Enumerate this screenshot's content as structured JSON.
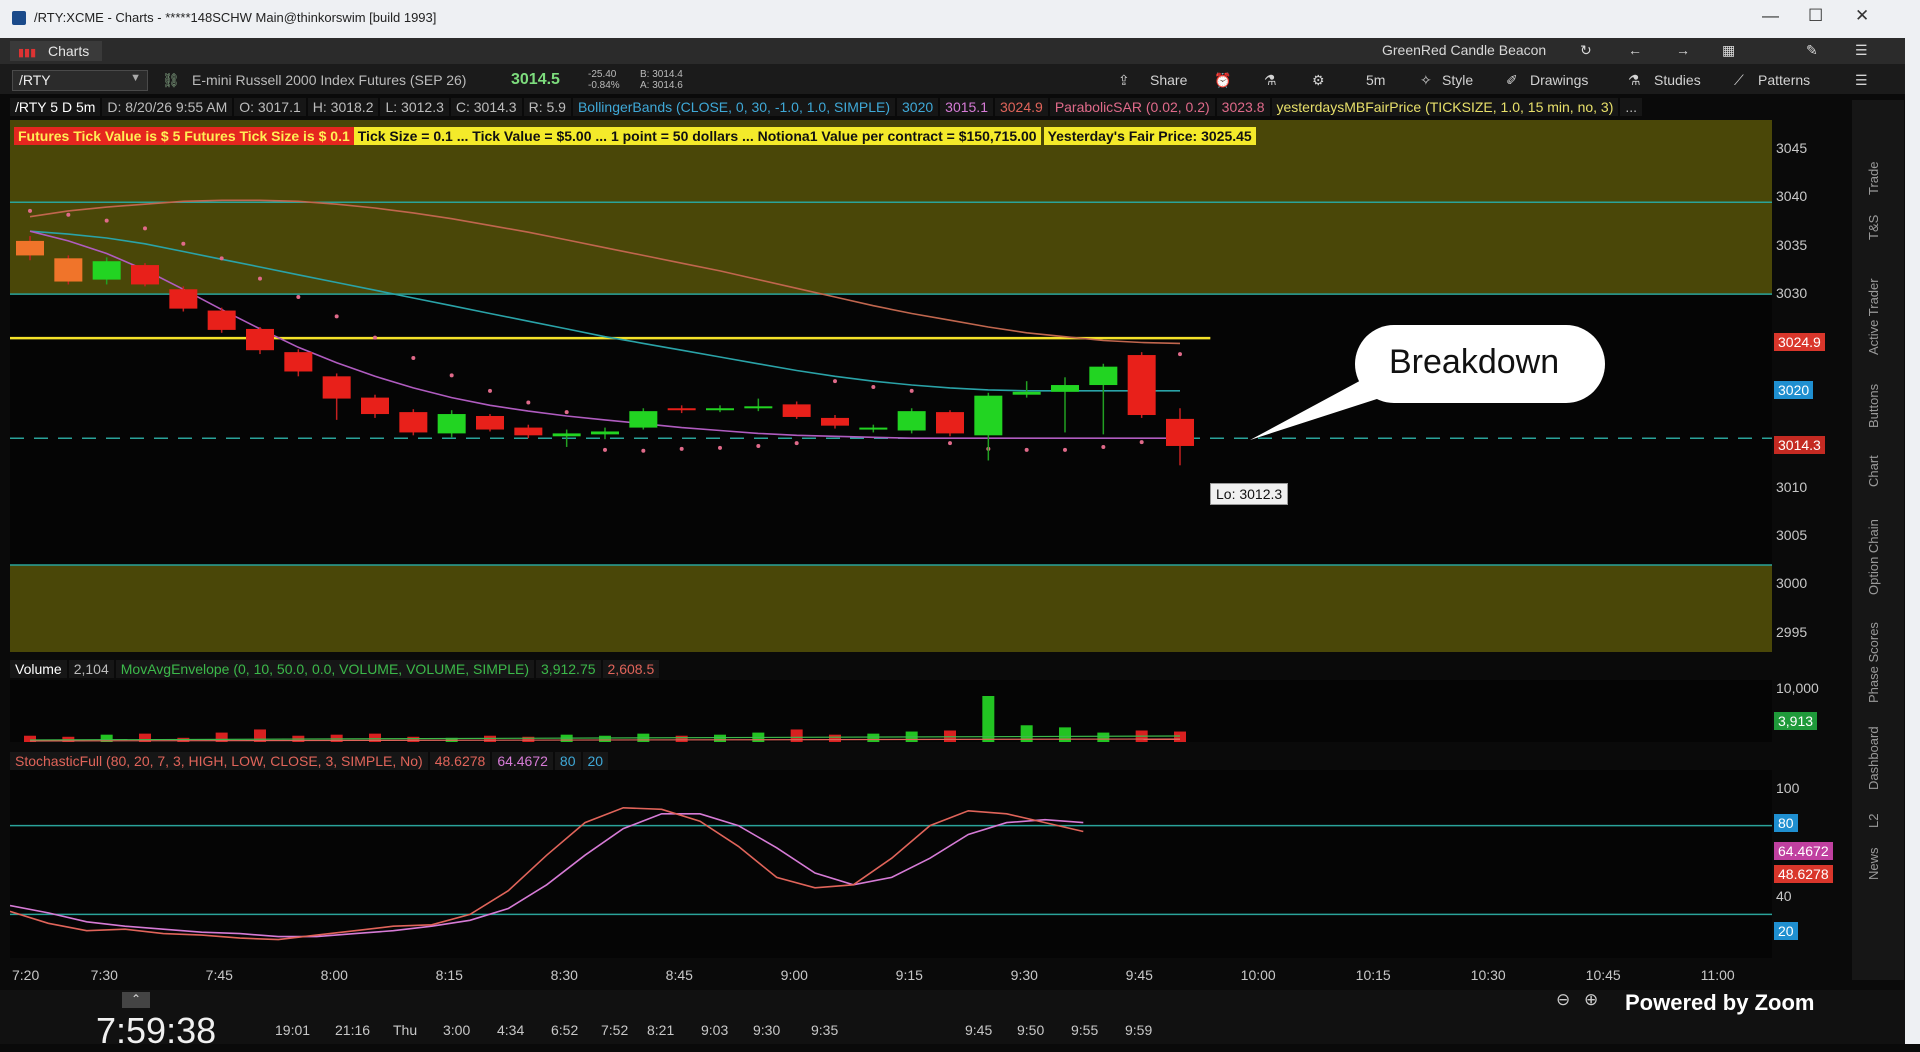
{
  "window": {
    "title": "/RTY:XCME - Charts - *****148SCHW Main@thinkorswim [build 1993]",
    "controls": [
      "—",
      "☐",
      "✕"
    ]
  },
  "topbar": {
    "tab_label": "Charts",
    "beacon_label": "GreenRed Candle Beacon"
  },
  "toolbar": {
    "symbol": "/RTY",
    "description": "E-mini Russell 2000 Index Futures (SEP 26)",
    "last": "3014.5",
    "change": "-25.40",
    "change_pct": "-0.84%",
    "bid": "B: 3014.4",
    "ask": "A: 3014.6",
    "share": "Share",
    "timeframe": "5m",
    "style": "Style",
    "drawings": "Drawings",
    "studies": "Studies",
    "patterns": "Patterns"
  },
  "header": {
    "cells": [
      {
        "text": "/RTY 5 D 5m",
        "color": "#ffffff"
      },
      {
        "text": "D: 8/20/26 9:55 AM",
        "color": "#bdbdbd"
      },
      {
        "text": "O: 3017.1",
        "color": "#bdbdbd"
      },
      {
        "text": "H: 3018.2",
        "color": "#bdbdbd"
      },
      {
        "text": "L: 3012.3",
        "color": "#bdbdbd"
      },
      {
        "text": "C: 3014.3",
        "color": "#bdbdbd"
      },
      {
        "text": "R: 5.9",
        "color": "#bdbdbd"
      },
      {
        "text": "BollingerBands (CLOSE, 0, 30, -1.0, 1.0, SIMPLE)",
        "color": "#3fa9d8"
      },
      {
        "text": "3020",
        "color": "#3fa9d8"
      },
      {
        "text": "3015.1",
        "color": "#d67bd6"
      },
      {
        "text": "3024.9",
        "color": "#e0645a"
      },
      {
        "text": "ParabolicSAR (0.02, 0.2)",
        "color": "#e06a8a"
      },
      {
        "text": "3023.8",
        "color": "#e06a8a"
      },
      {
        "text": "yesterdaysMBFairPrice (TICKSIZE, 1.0, 15 min, no, 3)",
        "color": "#e8e06a"
      },
      {
        "text": "...",
        "color": "#bdbdbd"
      }
    ]
  },
  "info": {
    "red_text": "Futures Tick Value is $ 5  Futures Tick Size is $ 0.1",
    "yellow_text": "Tick Size =  0.1 ... Tick Value =  $5.00 ... 1 point = 50 dollars ... Notiona1 Value per contract =  $150,715.00",
    "fair_text": "Yesterday's Fair Price: 3025.45"
  },
  "price_axis": {
    "labels": [
      "3045",
      "3040",
      "3035",
      "3030",
      "3010",
      "3005",
      "3000",
      "2995"
    ],
    "badges": [
      {
        "text": "3024.9",
        "color": "#d9362b"
      },
      {
        "text": "3020",
        "color": "#1f8fd0"
      },
      {
        "text": "3014.3",
        "color": "#c42a22"
      }
    ]
  },
  "chart_data": {
    "type": "candlestick",
    "y_range": [
      2993,
      3048
    ],
    "levels": {
      "yellow_line": 3025.45,
      "dashed_line": 3015.1,
      "zone_upper": [
        3030,
        3048
      ],
      "zone_lower": [
        2993,
        3002
      ],
      "cyan_lines": [
        3039.5,
        3030,
        3002
      ]
    },
    "candles": [
      {
        "o": 3035.5,
        "c": 3034.0,
        "h": 3036.0,
        "l": 3033.5
      },
      {
        "o": 3033.7,
        "c": 3031.3,
        "h": 3034.0,
        "l": 3031.0
      },
      {
        "o": 3031.5,
        "c": 3033.4,
        "h": 3033.8,
        "l": 3031.0
      },
      {
        "o": 3033.0,
        "c": 3031.0,
        "h": 3033.2,
        "l": 3030.8
      },
      {
        "o": 3030.5,
        "c": 3028.5,
        "h": 3030.8,
        "l": 3028.2
      },
      {
        "o": 3028.3,
        "c": 3026.3,
        "h": 3028.6,
        "l": 3026.0
      },
      {
        "o": 3026.4,
        "c": 3024.2,
        "h": 3026.6,
        "l": 3023.8
      },
      {
        "o": 3024.0,
        "c": 3022.0,
        "h": 3024.3,
        "l": 3021.5
      },
      {
        "o": 3021.5,
        "c": 3019.2,
        "h": 3021.8,
        "l": 3017.0
      },
      {
        "o": 3019.3,
        "c": 3017.6,
        "h": 3019.6,
        "l": 3017.2
      },
      {
        "o": 3017.8,
        "c": 3015.7,
        "h": 3018.1,
        "l": 3015.4
      },
      {
        "o": 3015.6,
        "c": 3017.6,
        "h": 3018.0,
        "l": 3015.2
      },
      {
        "o": 3017.4,
        "c": 3016.0,
        "h": 3017.6,
        "l": 3015.8
      },
      {
        "o": 3016.2,
        "c": 3015.4,
        "h": 3016.5,
        "l": 3015.1
      },
      {
        "o": 3015.3,
        "c": 3015.6,
        "h": 3016.0,
        "l": 3014.2
      },
      {
        "o": 3015.5,
        "c": 3015.8,
        "h": 3016.2,
        "l": 3015.0
      },
      {
        "o": 3016.2,
        "c": 3017.9,
        "h": 3018.2,
        "l": 3016.0
      },
      {
        "o": 3018.2,
        "c": 3018.0,
        "h": 3018.5,
        "l": 3017.7
      },
      {
        "o": 3018.0,
        "c": 3018.2,
        "h": 3018.5,
        "l": 3017.8
      },
      {
        "o": 3018.3,
        "c": 3018.4,
        "h": 3019.2,
        "l": 3017.9
      },
      {
        "o": 3018.6,
        "c": 3017.3,
        "h": 3018.9,
        "l": 3017.1
      },
      {
        "o": 3017.2,
        "c": 3016.4,
        "h": 3017.5,
        "l": 3016.1
      },
      {
        "o": 3016.0,
        "c": 3016.2,
        "h": 3016.5,
        "l": 3015.7
      },
      {
        "o": 3015.9,
        "c": 3017.9,
        "h": 3018.2,
        "l": 3015.6
      },
      {
        "o": 3017.8,
        "c": 3015.6,
        "h": 3018.0,
        "l": 3015.3
      },
      {
        "o": 3015.4,
        "c": 3019.5,
        "h": 3019.8,
        "l": 3012.8
      },
      {
        "o": 3019.6,
        "c": 3019.9,
        "h": 3021.0,
        "l": 3019.3
      },
      {
        "o": 3019.9,
        "c": 3020.6,
        "h": 3021.4,
        "l": 3015.7
      },
      {
        "o": 3020.6,
        "c": 3022.5,
        "h": 3022.8,
        "l": 3015.5
      },
      {
        "o": 3023.7,
        "c": 3017.5,
        "h": 3024.0,
        "l": 3017.2
      },
      {
        "o": 3017.1,
        "c": 3014.3,
        "h": 3018.2,
        "l": 3012.3
      }
    ],
    "bb_mid": [
      3036.5,
      3036.2,
      3035.8,
      3035.2,
      3034.4,
      3033.6,
      3032.8,
      3032.0,
      3031.2,
      3030.4,
      3029.6,
      3028.8,
      3028.0,
      3027.2,
      3026.4,
      3025.6,
      3024.9,
      3024.2,
      3023.5,
      3022.8,
      3022.1,
      3021.5,
      3021.0,
      3020.6,
      3020.3,
      3020.1,
      3020.0,
      3020.0,
      3020.0,
      3020.0,
      3020.0
    ],
    "bb_upper": [
      3038.0,
      3038.6,
      3039.0,
      3039.3,
      3039.6,
      3039.7,
      3039.7,
      3039.6,
      3039.3,
      3038.9,
      3038.4,
      3037.8,
      3037.1,
      3036.4,
      3035.6,
      3034.8,
      3034.0,
      3033.2,
      3032.4,
      3031.5,
      3030.6,
      3029.7,
      3028.8,
      3028.0,
      3027.3,
      3026.6,
      3026.0,
      3025.6,
      3025.2,
      3025.0,
      3024.9
    ],
    "bb_lower": [
      3036.5,
      3035.5,
      3034.2,
      3032.5,
      3030.5,
      3028.4,
      3026.4,
      3024.5,
      3022.9,
      3021.5,
      3020.3,
      3019.3,
      3018.5,
      3017.9,
      3017.4,
      3017.0,
      3016.6,
      3016.2,
      3015.9,
      3015.6,
      3015.4,
      3015.3,
      3015.2,
      3015.1,
      3015.1,
      3015.1,
      3015.1,
      3015.1,
      3015.1,
      3015.1,
      3015.1
    ],
    "sar": [
      3038.6,
      3038.2,
      3037.6,
      3036.8,
      3035.2,
      3033.7,
      3031.6,
      3029.7,
      3027.7,
      3025.5,
      3023.4,
      3021.6,
      3020.0,
      3018.8,
      3017.8,
      3013.9,
      3013.8,
      3014.0,
      3014.1,
      3014.3,
      3014.6,
      3021.0,
      3020.4,
      3020.0,
      3014.6,
      3014.0,
      3013.9,
      3013.9,
      3014.2,
      3014.7,
      3023.8
    ],
    "volume": [
      30,
      25,
      35,
      40,
      20,
      45,
      60,
      30,
      35,
      40,
      25,
      20,
      30,
      25,
      35,
      30,
      40,
      30,
      35,
      45,
      60,
      35,
      40,
      50,
      55,
      220,
      80,
      70,
      45,
      55,
      50
    ],
    "volume_range": [
      0,
      12000
    ],
    "stoch_k": [
      22,
      14,
      9,
      10,
      7,
      6,
      4,
      3,
      6,
      9,
      12,
      13,
      20,
      36,
      60,
      82,
      92,
      91,
      83,
      66,
      45,
      38,
      40,
      58,
      80,
      90,
      88,
      82,
      76
    ],
    "stoch_d": [
      26,
      21,
      15,
      12,
      10,
      8,
      7,
      5,
      5,
      7,
      9,
      12,
      16,
      24,
      40,
      60,
      78,
      88,
      88,
      80,
      65,
      48,
      40,
      45,
      58,
      74,
      82,
      84,
      82
    ],
    "stoch_range": [
      0,
      100
    ],
    "stoch_levels": [
      80,
      20
    ],
    "x_labels": [
      "7:20",
      "7:30",
      "7:45",
      "8:00",
      "8:15",
      "8:30",
      "8:45",
      "9:00",
      "9:15",
      "9:30",
      "9:45",
      "10:00",
      "10:15",
      "10:30",
      "10:45",
      "11:00"
    ]
  },
  "volume_header": {
    "label": "Volume",
    "value": "2,104",
    "study": "MovAvgEnvelope (0, 10, 50.0, 0.0, VOLUME, VOLUME, SIMPLE)",
    "v1": "3,912.75",
    "v2": "2,608.5",
    "axis_top": "10,000",
    "badge": "3,913"
  },
  "stoch_header": {
    "study": "StochasticFull (80, 20, 7, 3, HIGH, LOW, CLOSE, 3, SIMPLE, No)",
    "k": "48.6278",
    "d": "64.4672",
    "ob": "80",
    "os": "20",
    "axis": [
      "100",
      "40"
    ],
    "badges": [
      {
        "text": "80",
        "color": "#1f8fd0"
      },
      {
        "text": "64.4672",
        "color": "#c040a0"
      },
      {
        "text": "48.6278",
        "color": "#d9362b"
      },
      {
        "text": "20",
        "color": "#1f8fd0"
      }
    ]
  },
  "annotations": {
    "callout": "Breakdown",
    "lo_label": "Lo: 3012.3"
  },
  "side_tabs": [
    "Trade",
    "T&S",
    "Active Trader",
    "Buttons",
    "Chart",
    "Option Chain",
    "Phase Scores",
    "Dashboard",
    "L2",
    "News"
  ],
  "bottom": {
    "clock": "7:59:38",
    "timeline": [
      "19:01",
      "21:16",
      "Thu",
      "3:00",
      "4:34",
      "6:52",
      "7:52",
      "8:21",
      "9:03",
      "9:30",
      "9:35",
      "9:45",
      "9:50",
      "9:55",
      "9:59"
    ],
    "zoom_text": "Powered by Zoom"
  }
}
